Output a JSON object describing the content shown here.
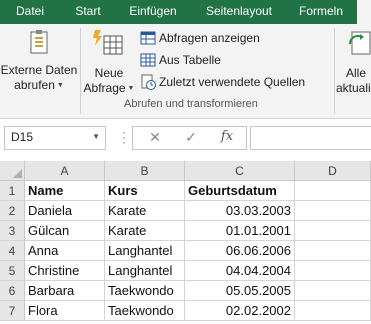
{
  "tabs": [
    "Datei",
    "Start",
    "Einfügen",
    "Seitenlayout",
    "Formeln",
    ""
  ],
  "active_tab_index": 5,
  "ribbon": {
    "external_data": {
      "line1": "Externe Daten",
      "line2": "abrufen"
    },
    "new_query": {
      "line1": "Neue",
      "line2": "Abfrage"
    },
    "show_queries": "Abfragen anzeigen",
    "from_table": "Aus Tabelle",
    "recent_sources": "Zuletzt verwendete Quellen",
    "group_label": "Abrufen und transformieren",
    "refresh_all": {
      "line1": "Alle",
      "line2": "aktualisie"
    }
  },
  "formula_bar": {
    "name_box": "D15",
    "cancel_symbol": "✕",
    "enter_symbol": "✓",
    "fx_symbol": "fx"
  },
  "columns": [
    "A",
    "B",
    "C",
    "D"
  ],
  "rows": [
    "1",
    "2",
    "3",
    "4",
    "5",
    "6",
    "7"
  ],
  "cells": [
    [
      "Name",
      "Kurs",
      "Geburtsdatum"
    ],
    [
      "Daniela",
      "Karate",
      "03.03.2003"
    ],
    [
      "Gülcan",
      "Karate",
      "01.01.2001"
    ],
    [
      "Anna",
      "Langhantel",
      "06.06.2006"
    ],
    [
      "Christine",
      "Langhantel",
      "04.04.2004"
    ],
    [
      "Barbara",
      "Taekwondo",
      "05.05.2005"
    ],
    [
      "Flora",
      "Taekwondo",
      "02.02.2002"
    ]
  ],
  "colors": {
    "excel_green": "#217346",
    "ribbon_bg": "#f3f3f3",
    "header_bg": "#e6e6e6"
  }
}
